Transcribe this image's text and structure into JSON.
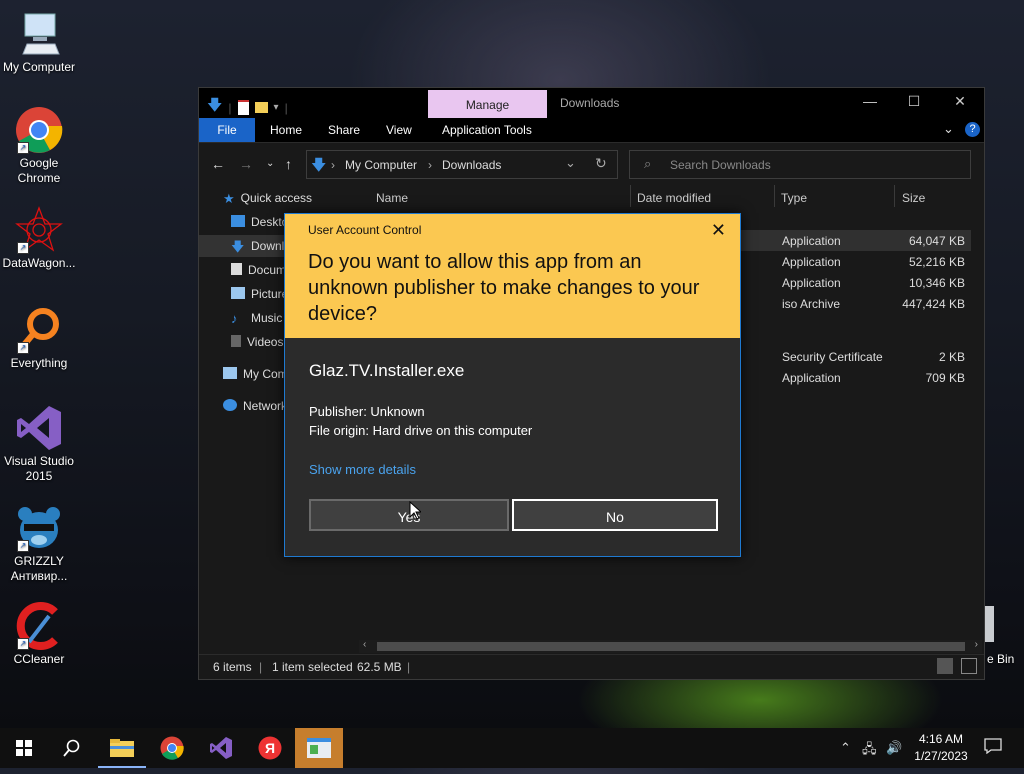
{
  "desktop": {
    "icons": [
      {
        "label": "My Computer",
        "icon": "monitor-icon"
      },
      {
        "label": "Google Chrome",
        "icon": "chrome-icon"
      },
      {
        "label": "DataWagon...",
        "icon": "datawagon-icon"
      },
      {
        "label": "Everything",
        "icon": "everything-icon"
      },
      {
        "label": "Visual Studio 2015",
        "icon": "visual-studio-icon"
      },
      {
        "label": "GRIZZLY Антивир...",
        "icon": "grizzly-icon"
      },
      {
        "label": "CCleaner",
        "icon": "ccleaner-icon"
      }
    ],
    "recycle_partial": "e Bin"
  },
  "explorer": {
    "manage_tab": "Manage",
    "title": "Downloads",
    "ribbon": {
      "file": "File",
      "home": "Home",
      "share": "Share",
      "view": "View",
      "app_tools": "Application Tools"
    },
    "address": {
      "root": "My Computer",
      "current": "Downloads"
    },
    "search_placeholder": "Search Downloads",
    "nav": {
      "quick_access": "Quick access",
      "desktop": "Desktop",
      "downloads": "Downloads",
      "documents": "Documents",
      "pictures": "Pictures",
      "music": "Music",
      "videos": "Videos",
      "my_computer": "My Computer",
      "network": "Network"
    },
    "columns": {
      "name": "Name",
      "date": "Date modified",
      "type": "Type",
      "size": "Size"
    },
    "rows": [
      {
        "type": "Application",
        "size": "64,047 KB"
      },
      {
        "type": "Application",
        "size": "52,216 KB"
      },
      {
        "type": "Application",
        "size": "10,346 KB"
      },
      {
        "type": "iso Archive",
        "size": "447,424 KB"
      },
      {
        "type": "Security Certificate",
        "size": "2 KB"
      },
      {
        "type": "Application",
        "size": "709 KB"
      }
    ],
    "status": {
      "items": "6 items",
      "selected": "1 item selected",
      "size": "62.5 MB"
    }
  },
  "uac": {
    "caption": "User Account Control",
    "question": "Do you want to allow this app from an unknown publisher to make changes to your device?",
    "app_name": "Glaz.TV.Installer.exe",
    "publisher": "Publisher: Unknown",
    "origin": "File origin: Hard drive on this computer",
    "more": "Show more details",
    "yes": "Yes",
    "no": "No"
  },
  "taskbar": {
    "time": "4:16 AM",
    "date": "1/27/2023"
  },
  "colors": {
    "uac_banner": "#fbc851",
    "accent": "#1a64c8",
    "manage_tab": "#e9c6f0",
    "taskbar_active": "#c67e2d"
  }
}
